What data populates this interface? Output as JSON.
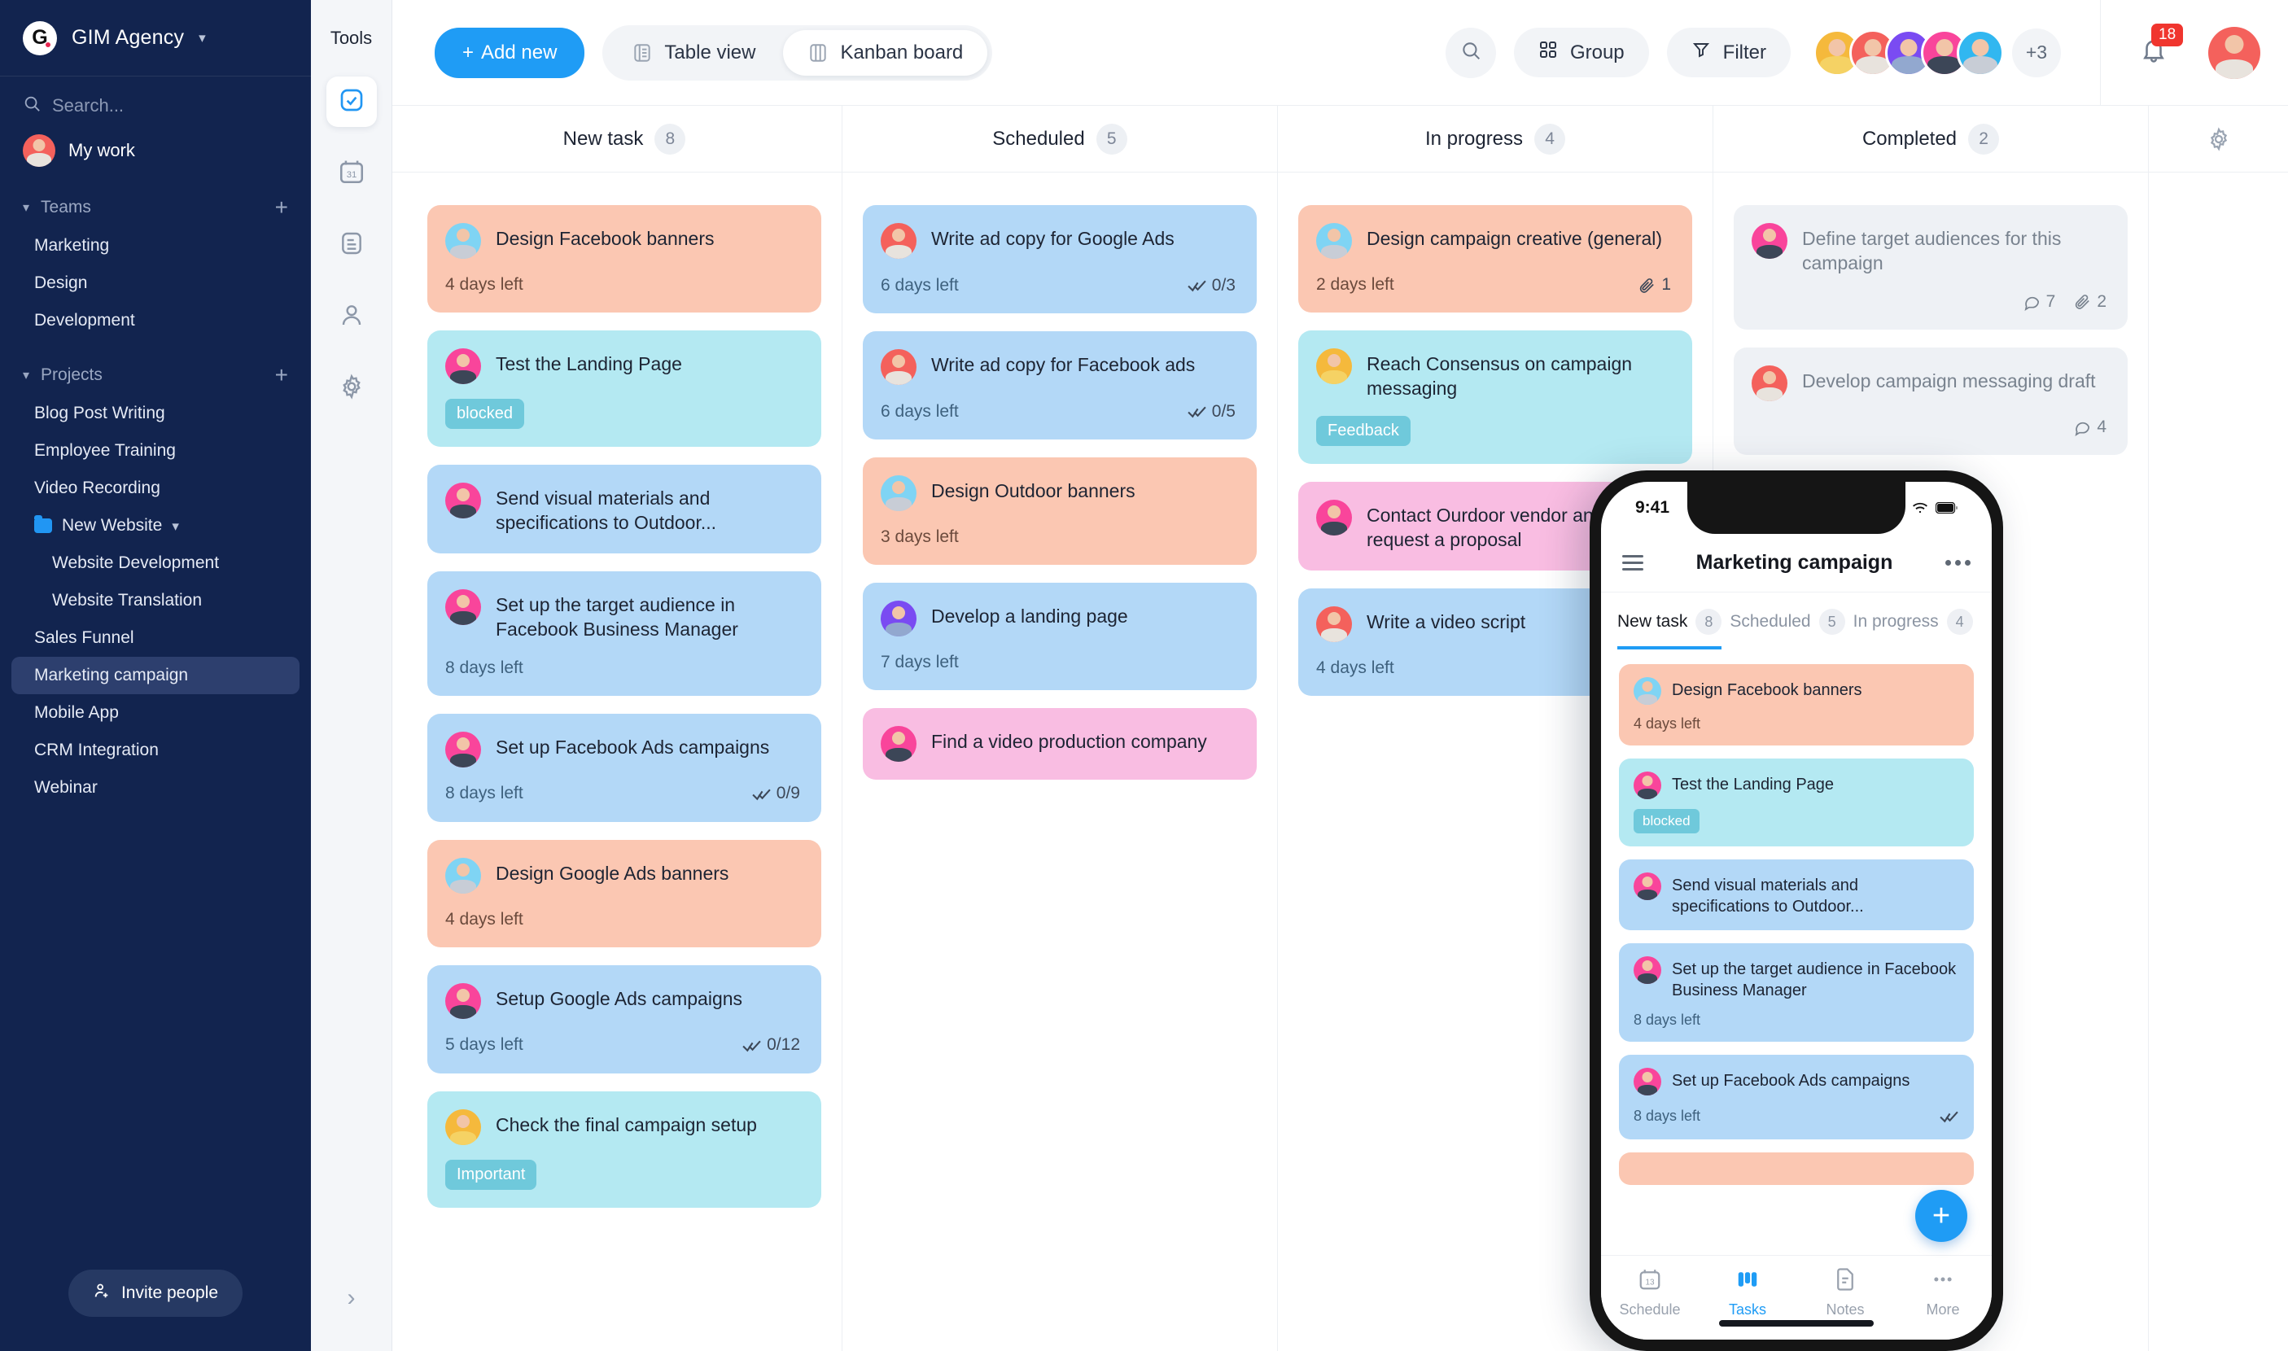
{
  "sidebar": {
    "brand": {
      "logo_text": "G",
      "name": "GIM Agency",
      "chevron": "chevron-down"
    },
    "search_placeholder": "Search...",
    "my_work": "My work",
    "teams_header": "Teams",
    "teams": [
      "Marketing",
      "Design",
      "Development"
    ],
    "projects_header": "Projects",
    "projects": [
      {
        "label": "Blog Post Writing",
        "type": "item",
        "active": false
      },
      {
        "label": "Employee Training",
        "type": "item",
        "active": false
      },
      {
        "label": "Video Recording",
        "type": "item",
        "active": false
      },
      {
        "label": "New Website",
        "type": "folder",
        "active": false
      },
      {
        "label": "Website Development",
        "type": "sub",
        "active": false
      },
      {
        "label": "Website Translation",
        "type": "sub",
        "active": false
      },
      {
        "label": "Sales Funnel",
        "type": "item",
        "active": false
      },
      {
        "label": "Marketing campaign",
        "type": "item",
        "active": true
      },
      {
        "label": "Mobile App",
        "type": "item",
        "active": false
      },
      {
        "label": "CRM Integration",
        "type": "item",
        "active": false
      },
      {
        "label": "Webinar",
        "type": "item",
        "active": false
      }
    ],
    "invite_label": "Invite people"
  },
  "rail": {
    "title": "Tools",
    "items": [
      {
        "name": "tasks-icon",
        "active": true
      },
      {
        "name": "calendar-icon",
        "active": false
      },
      {
        "name": "notes-icon",
        "active": false
      },
      {
        "name": "people-icon",
        "active": false
      },
      {
        "name": "settings-icon",
        "active": false
      }
    ]
  },
  "topbar": {
    "add_new": "Add new",
    "table_view": "Table view",
    "kanban_board": "Kanban board",
    "group": "Group",
    "filter": "Filter",
    "avatars_more": "+3",
    "notification_count": "18",
    "accent": "#1f9cf5"
  },
  "board": {
    "columns": [
      {
        "title": "New task",
        "count": "8",
        "cards": [
          {
            "title": "Design Facebook banners",
            "days": "4 days left",
            "color": "c-peach",
            "avatar": "male-glasses",
            "tag": null,
            "checks": null,
            "comments": null,
            "attachments": null
          },
          {
            "title": "Test the Landing Page",
            "days": null,
            "color": "c-cyan",
            "avatar": "female-pink",
            "tag": "blocked",
            "checks": null,
            "comments": null,
            "attachments": null
          },
          {
            "title": "Send visual materials and specifications to Outdoor...",
            "days": null,
            "color": "c-blue",
            "avatar": "female-pink",
            "tag": null,
            "checks": null,
            "comments": null,
            "attachments": null
          },
          {
            "title": "Set up the target audience in Facebook Business Manager",
            "days": "8 days left",
            "color": "c-blue",
            "avatar": "female-pink",
            "tag": null,
            "checks": null,
            "comments": null,
            "attachments": null
          },
          {
            "title": "Set up Facebook Ads campaigns",
            "days": "8 days left",
            "color": "c-blue",
            "avatar": "female-pink",
            "tag": null,
            "checks": "0/9",
            "comments": null,
            "attachments": null
          },
          {
            "title": "Design Google Ads banners",
            "days": "4 days left",
            "color": "c-peach",
            "avatar": "male-glasses",
            "tag": null,
            "checks": null,
            "comments": null,
            "attachments": null
          },
          {
            "title": "Setup Google Ads campaigns",
            "days": "5 days left",
            "color": "c-blue",
            "avatar": "female-pink",
            "tag": null,
            "checks": "0/12",
            "comments": null,
            "attachments": null
          },
          {
            "title": "Check the final campaign setup",
            "days": null,
            "color": "c-cyan",
            "avatar": "female-yellow",
            "tag": "Important",
            "checks": null,
            "comments": null,
            "attachments": null
          }
        ]
      },
      {
        "title": "Scheduled",
        "count": "5",
        "cards": [
          {
            "title": "Write ad copy for Google Ads",
            "days": "6 days left",
            "color": "c-blue",
            "avatar": "female-red",
            "tag": null,
            "checks": "0/3",
            "comments": null,
            "attachments": null
          },
          {
            "title": "Write ad copy for Facebook ads",
            "days": "6 days left",
            "color": "c-blue",
            "avatar": "female-red",
            "tag": null,
            "checks": "0/5",
            "comments": null,
            "attachments": null
          },
          {
            "title": "Design Outdoor banners",
            "days": "3 days left",
            "color": "c-peach",
            "avatar": "male-glasses",
            "tag": null,
            "checks": null,
            "comments": null,
            "attachments": null
          },
          {
            "title": "Develop a landing page",
            "days": "7 days left",
            "color": "c-blue",
            "avatar": "male-purple",
            "tag": null,
            "checks": null,
            "comments": null,
            "attachments": null
          },
          {
            "title": "Find a video production company",
            "days": null,
            "color": "c-pink",
            "avatar": "female-pink",
            "tag": null,
            "checks": null,
            "comments": null,
            "attachments": null
          }
        ]
      },
      {
        "title": "In progress",
        "count": "4",
        "cards": [
          {
            "title": "Design campaign creative (general)",
            "days": "2 days left",
            "color": "c-peach",
            "avatar": "male-glasses",
            "tag": null,
            "checks": null,
            "comments": null,
            "attachments": "1"
          },
          {
            "title": "Reach Consensus on campaign messaging",
            "days": null,
            "color": "c-cyan",
            "avatar": "female-yellow",
            "tag": "Feedback",
            "checks": null,
            "comments": null,
            "attachments": null
          },
          {
            "title": "Contact Ourdoor vendor and request a proposal",
            "days": null,
            "color": "c-pink",
            "avatar": "female-pink",
            "tag": null,
            "checks": null,
            "comments": null,
            "attachments": null
          },
          {
            "title": "Write a video script",
            "days": "4 days left",
            "color": "c-blue",
            "avatar": "female-red",
            "tag": null,
            "checks": null,
            "comments": null,
            "attachments": null
          }
        ]
      },
      {
        "title": "Completed",
        "count": "2",
        "cards": [
          {
            "title": "Define target audiences for this campaign",
            "days": null,
            "color": "c-grey",
            "avatar": "female-pink",
            "tag": null,
            "checks": null,
            "comments": "7",
            "attachments": "2"
          },
          {
            "title": "Develop campaign messaging draft",
            "days": null,
            "color": "c-grey",
            "avatar": "female-red",
            "tag": null,
            "checks": null,
            "comments": "4",
            "attachments": null
          }
        ]
      }
    ]
  },
  "phone": {
    "time": "9:41",
    "title": "Marketing campaign",
    "tabs": [
      {
        "label": "New task",
        "count": "8",
        "active": true
      },
      {
        "label": "Scheduled",
        "count": "5",
        "active": false
      },
      {
        "label": "In progress",
        "count": "4",
        "active": false
      }
    ],
    "cards": [
      {
        "title": "Design Facebook banners",
        "days": "4 days left",
        "color": "c-peach",
        "avatar": "male-glasses",
        "tag": null,
        "checks": null
      },
      {
        "title": "Test the Landing Page",
        "days": null,
        "color": "c-cyan",
        "avatar": "female-pink",
        "tag": "blocked",
        "checks": null
      },
      {
        "title": "Send visual materials and specifications to Outdoor...",
        "days": null,
        "color": "c-blue",
        "avatar": "female-pink",
        "tag": null,
        "checks": null
      },
      {
        "title": "Set up the target audience in Facebook Business Manager",
        "days": "8 days left",
        "color": "c-blue",
        "avatar": "female-pink",
        "tag": null,
        "checks": null
      },
      {
        "title": "Set up Facebook Ads campaigns",
        "days": "8 days left",
        "color": "c-blue",
        "avatar": "female-pink",
        "tag": null,
        "checks": ""
      }
    ],
    "fab": "+",
    "nav": [
      {
        "label": "Schedule",
        "icon": "calendar-13-icon",
        "active": false
      },
      {
        "label": "Tasks",
        "icon": "kanban-icon",
        "active": true
      },
      {
        "label": "Notes",
        "icon": "notes-icon",
        "active": false
      },
      {
        "label": "More",
        "icon": "ellipsis-icon",
        "active": false
      }
    ]
  }
}
